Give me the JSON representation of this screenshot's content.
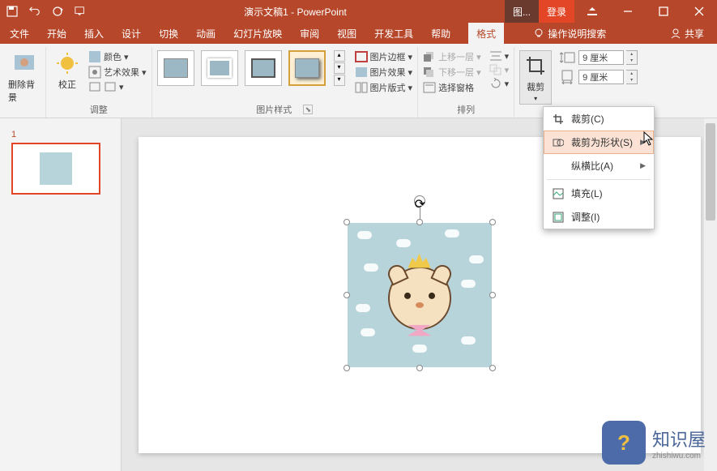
{
  "title": "演示文稿1 - PowerPoint",
  "titlebar": {
    "context_tab": "图...",
    "login": "登录"
  },
  "menu": {
    "file": "文件",
    "home": "开始",
    "insert": "插入",
    "design": "设计",
    "transitions": "切换",
    "animations": "动画",
    "slideshow": "幻灯片放映",
    "review": "审阅",
    "view": "视图",
    "developer": "开发工具",
    "help": "帮助",
    "format": "格式",
    "tellme": "操作说明搜索",
    "share": "共享"
  },
  "ribbon": {
    "remove_bg": "删除背景",
    "corrections": "校正",
    "color": "颜色",
    "artistic": "艺术效果",
    "adjust_group": "调整",
    "pic_border": "图片边框",
    "pic_effects": "图片效果",
    "pic_layout": "图片版式",
    "styles_group": "图片样式",
    "bring_forward": "上移一层",
    "send_backward": "下移一层",
    "selection_pane": "选择窗格",
    "arrange_group": "排列",
    "crop": "裁剪",
    "height_val": "9 厘米",
    "width_val": "9 厘米"
  },
  "crop_menu": {
    "crop": "裁剪(C)",
    "crop_to_shape": "裁剪为形状(S)",
    "aspect_ratio": "纵横比(A)",
    "fill": "填充(L)",
    "fit": "调整(I)"
  },
  "slide_num": "1",
  "watermark": {
    "text": "知识屋",
    "url": "zhishiwu.com"
  }
}
